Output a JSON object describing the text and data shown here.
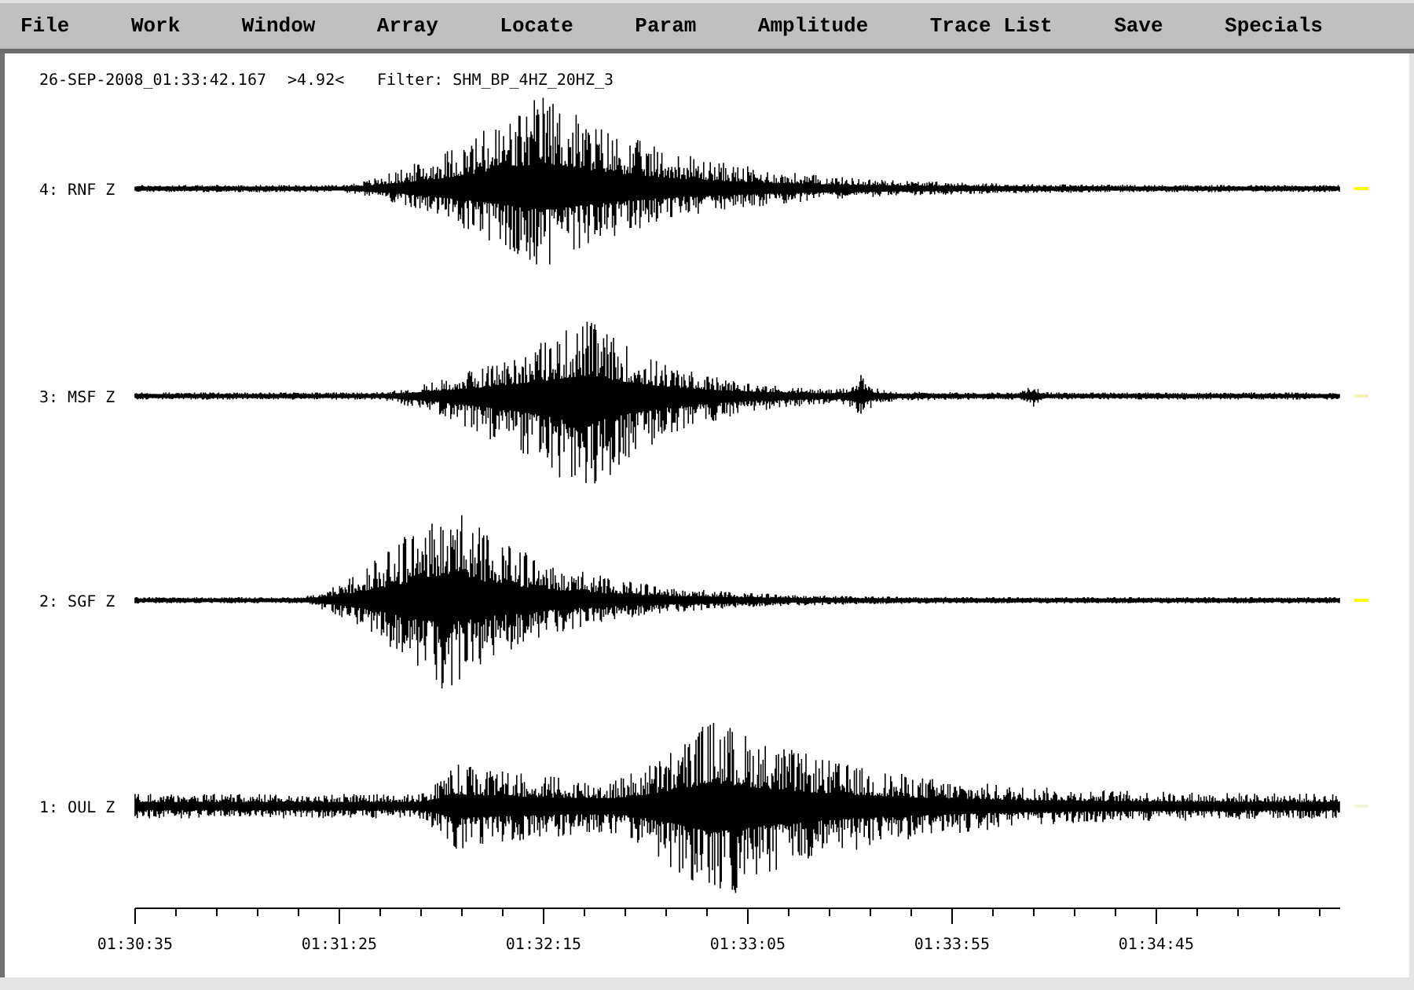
{
  "menu": [
    "File",
    "Work",
    "Window",
    "Array",
    "Locate",
    "Param",
    "Amplitude",
    "Trace List",
    "Save",
    "Specials"
  ],
  "header": {
    "time": "26-SEP-2008_01:33:42.167",
    "amplitude": ">4.92<",
    "filter": "Filter: SHM_BP_4HZ_20HZ_3"
  },
  "traces": [
    {
      "label": "4: RNF Z",
      "color": "#ffff00"
    },
    {
      "label": "3: MSF Z",
      "color": "#f4f4b8"
    },
    {
      "label": "2: SGF Z",
      "color": "#ffff00"
    },
    {
      "label": "1: OUL Z",
      "color": "#f4f4d8"
    }
  ],
  "time_axis": {
    "labels": [
      "01:30:35",
      "01:31:25",
      "01:32:15",
      "01:33:05",
      "01:33:55",
      "01:34:45"
    ]
  }
}
